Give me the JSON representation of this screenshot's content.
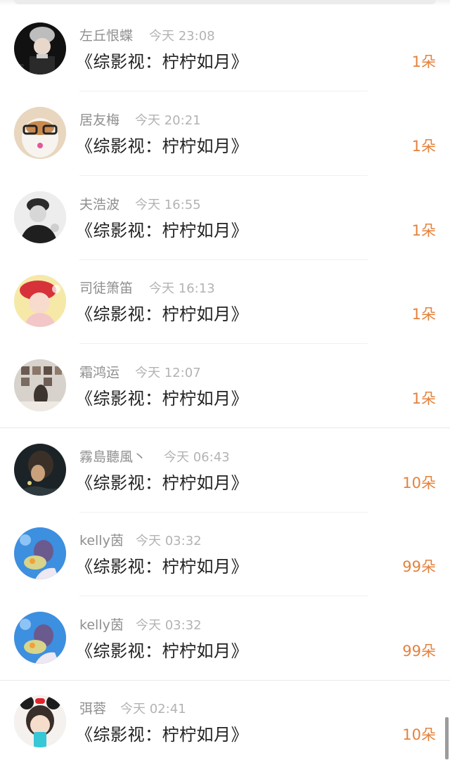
{
  "colors": {
    "accent": "#e4823c",
    "name": "#8f8f8f",
    "time": "#b3b3b3",
    "title": "#222222"
  },
  "gift_list": [
    {
      "name": "左丘恨蝶",
      "time": "今天 23:08",
      "title": "《综影视：柠柠如月》",
      "amount": "1朵",
      "avatar_icon": "avatar-boy-knit-hat"
    },
    {
      "name": "居友梅",
      "time": "今天 20:21",
      "title": "《综影视：柠柠如月》",
      "amount": "1朵",
      "avatar_icon": "avatar-cat-glasses"
    },
    {
      "name": "夫浩波",
      "time": "今天 16:55",
      "title": "《综影视：柠柠如月》",
      "amount": "1朵",
      "avatar_icon": "avatar-man-portrait"
    },
    {
      "name": "司徒箫笛",
      "time": "今天 16:13",
      "title": "《综影视：柠柠如月》",
      "amount": "1朵",
      "avatar_icon": "avatar-girl-red-beret"
    },
    {
      "name": "霜鸿运",
      "time": "今天 12:07",
      "title": "《综影视：柠柠如月》",
      "amount": "1朵",
      "avatar_icon": "avatar-room-photo-wall"
    },
    {
      "name": "霧島聽風丶",
      "time": "今天 06:43",
      "title": "《综影视：柠柠如月》",
      "amount": "10朵",
      "avatar_icon": "avatar-dark-portrait"
    },
    {
      "name": "kelly茵",
      "time": "今天 03:32",
      "title": "《综影视：柠柠如月》",
      "amount": "99朵",
      "avatar_icon": "avatar-girl-blue-sky"
    },
    {
      "name": "kelly茵",
      "time": "今天 03:32",
      "title": "《综影视：柠柠如月》",
      "amount": "99朵",
      "avatar_icon": "avatar-girl-blue-sky"
    },
    {
      "name": "弭蓉",
      "time": "今天 02:41",
      "title": "《综影视：柠柠如月》",
      "amount": "10朵",
      "avatar_icon": "avatar-girl-mouse-ears"
    }
  ]
}
